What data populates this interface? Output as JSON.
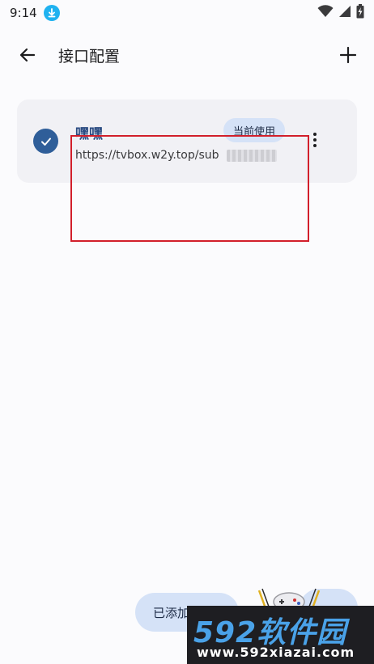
{
  "status_bar": {
    "time": "9:14",
    "icons": [
      "download-icon",
      "wifi-icon",
      "signal-icon",
      "battery-charging-icon"
    ],
    "download_badge_color": "#1fb2f0"
  },
  "app_bar": {
    "title": "接口配置",
    "back_icon": "arrow-left-icon",
    "add_icon": "plus-icon"
  },
  "configs": [
    {
      "name": "嘿嘿",
      "url": "https://tvbox.w2y.top/sub",
      "url_suffix_redacted": true,
      "badge": "当前使用",
      "selected": true,
      "more_icon": "more-vertical-icon"
    }
  ],
  "bottom": {
    "added_label": "已添加",
    "gamepad_icon": "gamepad-icon"
  },
  "watermark": {
    "title": "592软件园",
    "url": "www.592xiazai.com"
  },
  "colors": {
    "accent": "#2f5e99",
    "chip_bg": "#d5e2f7",
    "card_bg": "#f1f1f5",
    "highlight_border": "#d21f2b"
  }
}
